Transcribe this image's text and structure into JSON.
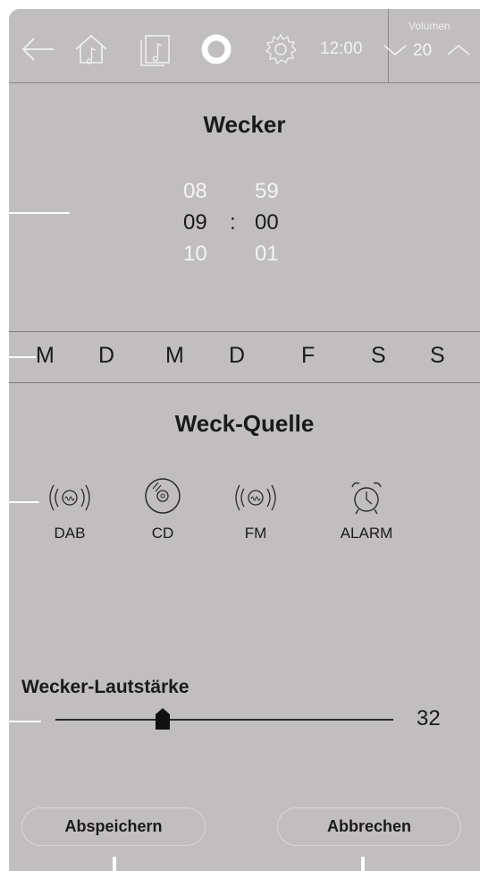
{
  "header": {
    "clock": "12:00",
    "volume_label": "Volumen",
    "volume_value": "20",
    "icons": [
      "back-arrow-icon",
      "home-music-icon",
      "music-library-icon",
      "alexa-ring-icon",
      "settings-gear-icon",
      "chevron-down-icon",
      "chevron-up-icon"
    ]
  },
  "alarm": {
    "title": "Wecker",
    "hours": {
      "prev": "08",
      "current": "09",
      "next": "10"
    },
    "separator": ":",
    "minutes": {
      "prev": "59",
      "current": "00",
      "next": "01"
    }
  },
  "days": [
    "M",
    "D",
    "M",
    "D",
    "F",
    "S",
    "S"
  ],
  "wake_source": {
    "title": "Weck-Quelle",
    "options": [
      {
        "label": "DAB",
        "icon": "radio-waves-icon"
      },
      {
        "label": "CD",
        "icon": "cd-disc-icon"
      },
      {
        "label": "FM",
        "icon": "radio-waves-icon"
      },
      {
        "label": "ALARM",
        "icon": "alarm-clock-icon"
      }
    ]
  },
  "alarm_volume": {
    "label": "Wecker-Lautstärke",
    "value": "32",
    "level_fraction": 0.32
  },
  "buttons": {
    "save": "Abspeichern",
    "cancel": "Abbrechen"
  },
  "colors": {
    "panel": "#c0bebe",
    "text_dark": "#1a1a1a",
    "text_light": "#f4f4f4"
  }
}
